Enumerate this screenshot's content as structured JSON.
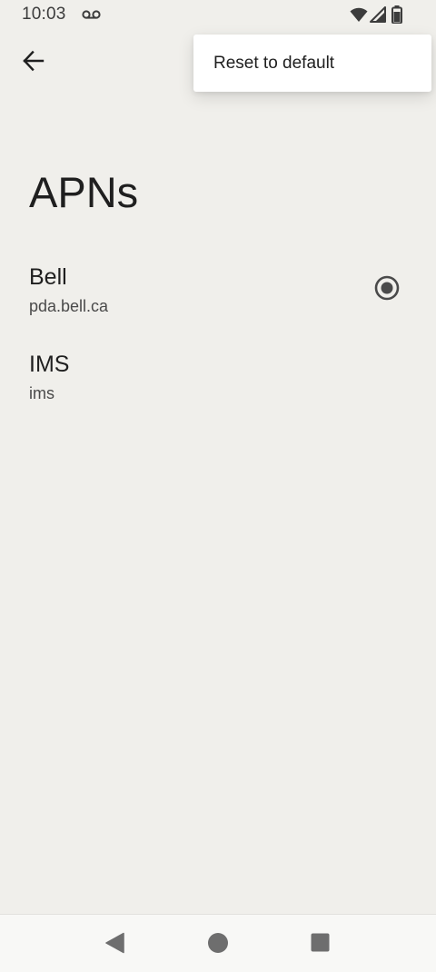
{
  "status_bar": {
    "time": "10:03",
    "icons": [
      "voicemail-icon",
      "wifi-icon",
      "signal-icon",
      "battery-icon"
    ]
  },
  "toolbar": {
    "back_icon": "arrow-back-icon"
  },
  "menu": {
    "items": [
      {
        "label": "Reset to default"
      }
    ]
  },
  "page": {
    "title": "APNs"
  },
  "apns": [
    {
      "name": "Bell",
      "apn": "pda.bell.ca",
      "selected": true
    },
    {
      "name": "IMS",
      "apn": "ims",
      "selected": false
    }
  ],
  "nav_bar": {
    "buttons": [
      "back-triangle-icon",
      "home-circle-icon",
      "recents-square-icon"
    ]
  },
  "colors": {
    "background": "#f0efeb",
    "radio_accent": "#4a4a4a",
    "text_primary": "#1f1f1f"
  }
}
